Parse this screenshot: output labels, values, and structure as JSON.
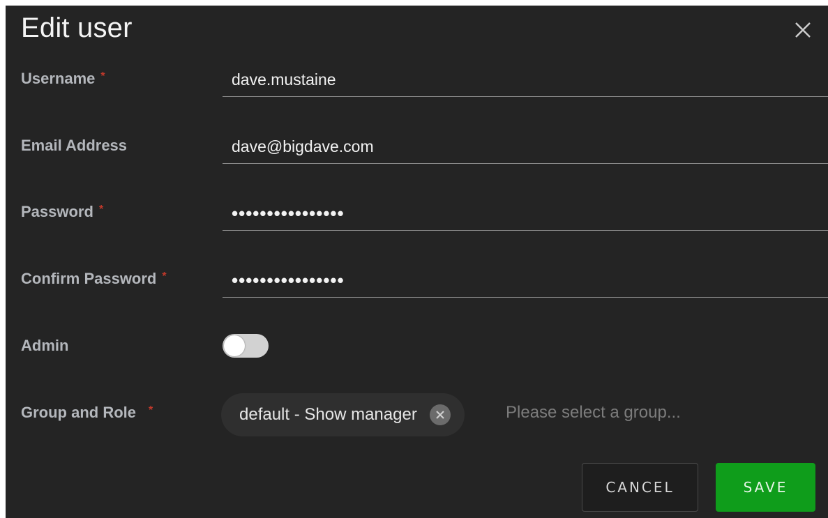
{
  "dialog": {
    "title": "Edit user",
    "close_icon": "close-icon"
  },
  "form": {
    "username": {
      "label": "Username",
      "required_mark": "*",
      "value": "dave.mustaine"
    },
    "email": {
      "label": "Email Address",
      "value": "dave@bigdave.com"
    },
    "password": {
      "label": "Password",
      "required_mark": "*",
      "value": "••••••••••••••••"
    },
    "confirm_password": {
      "label": "Confirm Password",
      "required_mark": "*",
      "value": "••••••••••••••••"
    },
    "admin": {
      "label": "Admin",
      "enabled": false
    },
    "group_role": {
      "label": "Group and Role",
      "required_mark": "*",
      "selected_chip": "default - Show manager",
      "chip_remove_icon": "remove-icon",
      "placeholder": "Please select a group..."
    }
  },
  "actions": {
    "cancel_label": "CANCEL",
    "save_label": "SAVE"
  },
  "colors": {
    "background": "#242424",
    "label": "#b4b7bc",
    "required": "#c0392b",
    "save": "#0f9d1b"
  }
}
